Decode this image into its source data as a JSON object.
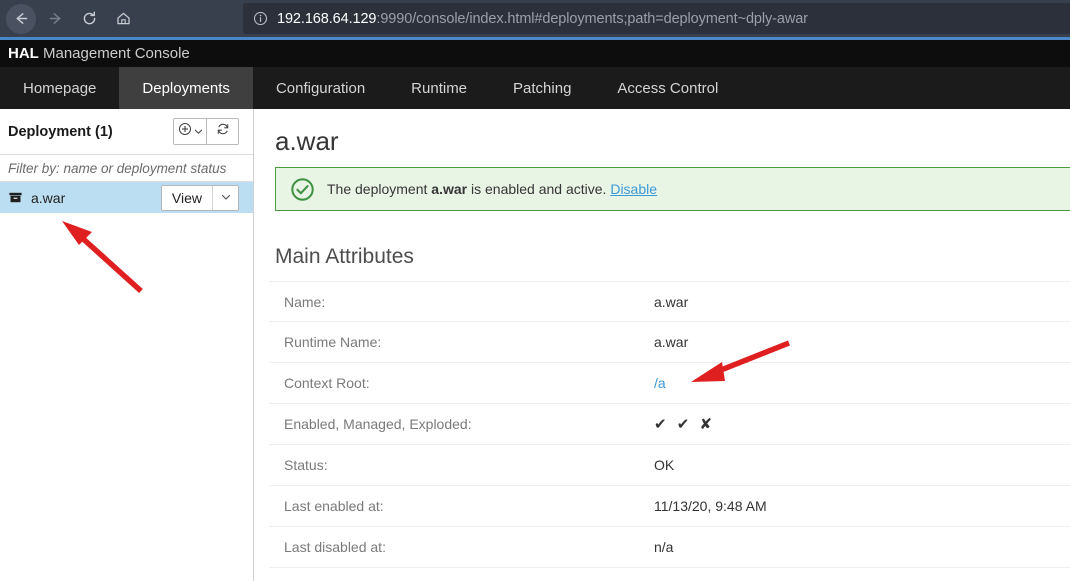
{
  "browser": {
    "back_icon": "back-arrow-icon",
    "forward_icon": "forward-arrow-icon",
    "reload_icon": "reload-icon",
    "home_icon": "home-icon",
    "info_icon": "info-circle-icon",
    "url_host": "192.168.64.129",
    "url_rest": ":9990/console/index.html#deployments;path=deployment~dply-awar",
    "url_full": "192.168.64.129:9990/console/index.html#deployments;path=deployment~dply-awar"
  },
  "header": {
    "brand": "HAL",
    "title_rest": " Management Console",
    "tabs": [
      {
        "label": "Homepage",
        "active": false
      },
      {
        "label": "Deployments",
        "active": true
      },
      {
        "label": "Configuration",
        "active": false
      },
      {
        "label": "Runtime",
        "active": false
      },
      {
        "label": "Patching",
        "active": false
      },
      {
        "label": "Access Control",
        "active": false
      }
    ]
  },
  "sidebar": {
    "title": "Deployment (1)",
    "add_icon": "circle-plus-icon",
    "add_caret_icon": "chevron-down-icon",
    "refresh_icon": "refresh-icon",
    "filter_placeholder": "Filter by: name or deployment status",
    "filter_value": "",
    "item": {
      "icon": "archive-box-icon",
      "label": "a.war",
      "view_label": "View",
      "caret_icon": "chevron-down-icon",
      "selected": true
    }
  },
  "main": {
    "page_title": "a.war",
    "alert": {
      "icon": "check-circle-icon",
      "text_before": "The deployment ",
      "deployment_name": "a.war",
      "text_after": " is enabled and active. ",
      "link_label": "Disable"
    },
    "section_title": "Main Attributes",
    "attributes": [
      {
        "label": "Name:",
        "value": "a.war",
        "is_link": false
      },
      {
        "label": "Runtime Name:",
        "value": "a.war",
        "is_link": false
      },
      {
        "label": "Context Root:",
        "value": "/a",
        "is_link": true
      },
      {
        "label": "Enabled, Managed, Exploded:",
        "value": "✔ ✔ ✘",
        "is_link": false
      },
      {
        "label": "Status:",
        "value": "OK",
        "is_link": false
      },
      {
        "label": "Last enabled at:",
        "value": "11/13/20, 9:48 AM",
        "is_link": false
      },
      {
        "label": "Last disabled at:",
        "value": "n/a",
        "is_link": false
      }
    ]
  },
  "annotations": {
    "arrow_1_target": "deployment-list-item",
    "arrow_2_target": "context-root-value",
    "color": "#e02020"
  },
  "colors": {
    "accent_blue": "#4a86c8",
    "link_blue": "#3b9ad9",
    "alert_green_border": "#4e9a3e",
    "alert_green_bg": "#e8f4e4",
    "selection_blue": "#bcdef2",
    "chrome_dark": "#38404e"
  }
}
